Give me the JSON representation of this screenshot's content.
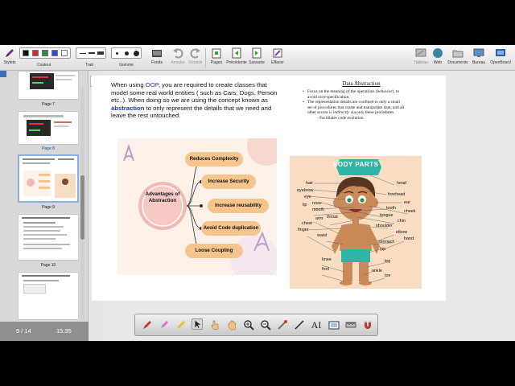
{
  "toolbar": {
    "left": [
      {
        "label": "Stylets",
        "icon": "pen-icon"
      },
      {
        "label": "Couleur",
        "icon": "color-palette-icon"
      },
      {
        "label": "Trait",
        "icon": "line-style-icon"
      },
      {
        "label": "Gomme",
        "icon": "eraser-icon"
      },
      {
        "label": "Fonds",
        "icon": "background-icon"
      },
      {
        "label": "Annuler",
        "icon": "undo-icon"
      },
      {
        "label": "Rétablir",
        "icon": "redo-icon"
      },
      {
        "label": "Pages",
        "icon": "pages-icon"
      },
      {
        "label": "Précédente",
        "icon": "previous-page-icon"
      },
      {
        "label": "Suivante",
        "icon": "next-page-icon"
      },
      {
        "label": "Effacer",
        "icon": "clear-page-icon"
      }
    ],
    "right": [
      {
        "label": "Tableau",
        "icon": "board-icon"
      },
      {
        "label": "Web",
        "icon": "web-globe-icon"
      },
      {
        "label": "Documents",
        "icon": "documents-folder-icon"
      },
      {
        "label": "Bureau",
        "icon": "desktop-icon"
      },
      {
        "label": "OpenBoard",
        "icon": "openboard-icon"
      }
    ],
    "colors": [
      "#111111",
      "#d42a2a",
      "#2a8c3a",
      "#2c4fd0",
      "#ffffff"
    ]
  },
  "sidebar": {
    "thumbnails": [
      {
        "label": "Page 7"
      },
      {
        "label": "Page 8"
      },
      {
        "label": "Page 9"
      },
      {
        "label": "Page 10"
      }
    ],
    "page_counter": "9 / 14",
    "clock": "15:35"
  },
  "slide": {
    "intro_1": "When using ",
    "intro_oop": "OOP",
    "intro_2": ", you are required to create classes that model some real world entities ( such as Cars, Dogs, Person etc..). When doing so we are using the concept known as ",
    "intro_abstraction": "abstraction",
    "intro_3": " to only represent the details that we need and leave the rest untouched.",
    "right_title": "Data Abstraction",
    "bullet1_a": "Focus on the meaning of the operations (",
    "bullet1_em": "behavior",
    "bullet1_b": "), to avoid over-specification.",
    "bullet2_a": "The representation details are confined to only a small set of procedures that create and manipulate data, and all other access is ",
    "bullet2_em": "indirectly",
    "bullet2_b": " via only these procedures.",
    "sub_bullet": "- Facilitates code evolution.",
    "advantages": {
      "center": "Advantages of Abstraction",
      "items": [
        "Reduces Complexity",
        "Increase Security",
        "Increase reusability",
        "Avoid Code duplication",
        "Loose Coupling"
      ]
    },
    "body_parts": {
      "title": "BODY PARTS",
      "left_labels": [
        "hair",
        "eyebrow",
        "eye",
        "lip",
        "nose",
        "mouth",
        "arm",
        "chest",
        "finger",
        "throat",
        "waist",
        "knee",
        "foot"
      ],
      "right_labels": [
        "head",
        "forehead",
        "ear",
        "tooth",
        "cheek",
        "tongue",
        "chin",
        "shoulder",
        "elbow",
        "hand",
        "stomach",
        "hip",
        "leg",
        "ankle",
        "toe"
      ]
    }
  },
  "bottom_tools": [
    "pen-tool-icon",
    "highlighter-icon",
    "marker-icon",
    "selector-icon",
    "hand-pointer-icon",
    "pan-hand-icon",
    "zoom-in-icon",
    "zoom-out-icon",
    "laser-pointer-icon",
    "line-tool-icon",
    "text-tool-icon",
    "capture-icon",
    "ruler-icon",
    "magnet-icon"
  ]
}
